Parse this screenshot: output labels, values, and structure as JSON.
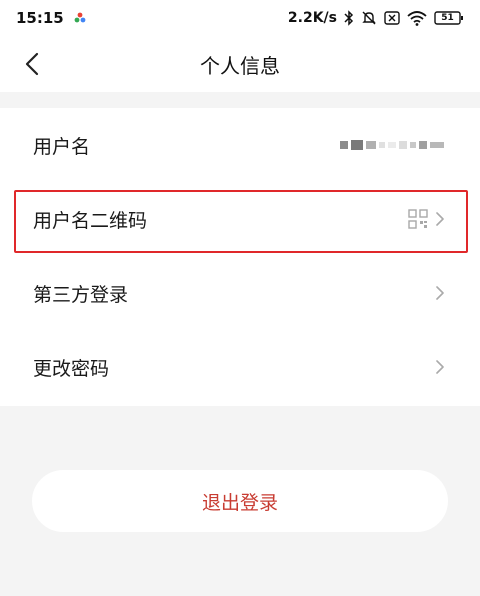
{
  "status_bar": {
    "time": "15:15",
    "network_speed": "2.2K/s",
    "battery": "51",
    "icons": [
      "app-notification-icon",
      "bluetooth-icon",
      "mute-icon",
      "sim-x-icon",
      "wifi-icon",
      "battery-icon"
    ]
  },
  "header": {
    "title": "个人信息",
    "back_icon": "back-chevron-icon"
  },
  "list": {
    "items": [
      {
        "label": "用户名",
        "value_obscured": true
      },
      {
        "label": "用户名二维码",
        "icon": "qr-code-icon",
        "highlighted": true
      },
      {
        "label": "第三方登录"
      },
      {
        "label": "更改密码"
      }
    ]
  },
  "logout": {
    "label": "退出登录"
  },
  "colors": {
    "accent_red": "#c83c32",
    "highlight_border": "#e0282a",
    "page_bg": "#f4f4f4",
    "card_bg": "#ffffff"
  }
}
